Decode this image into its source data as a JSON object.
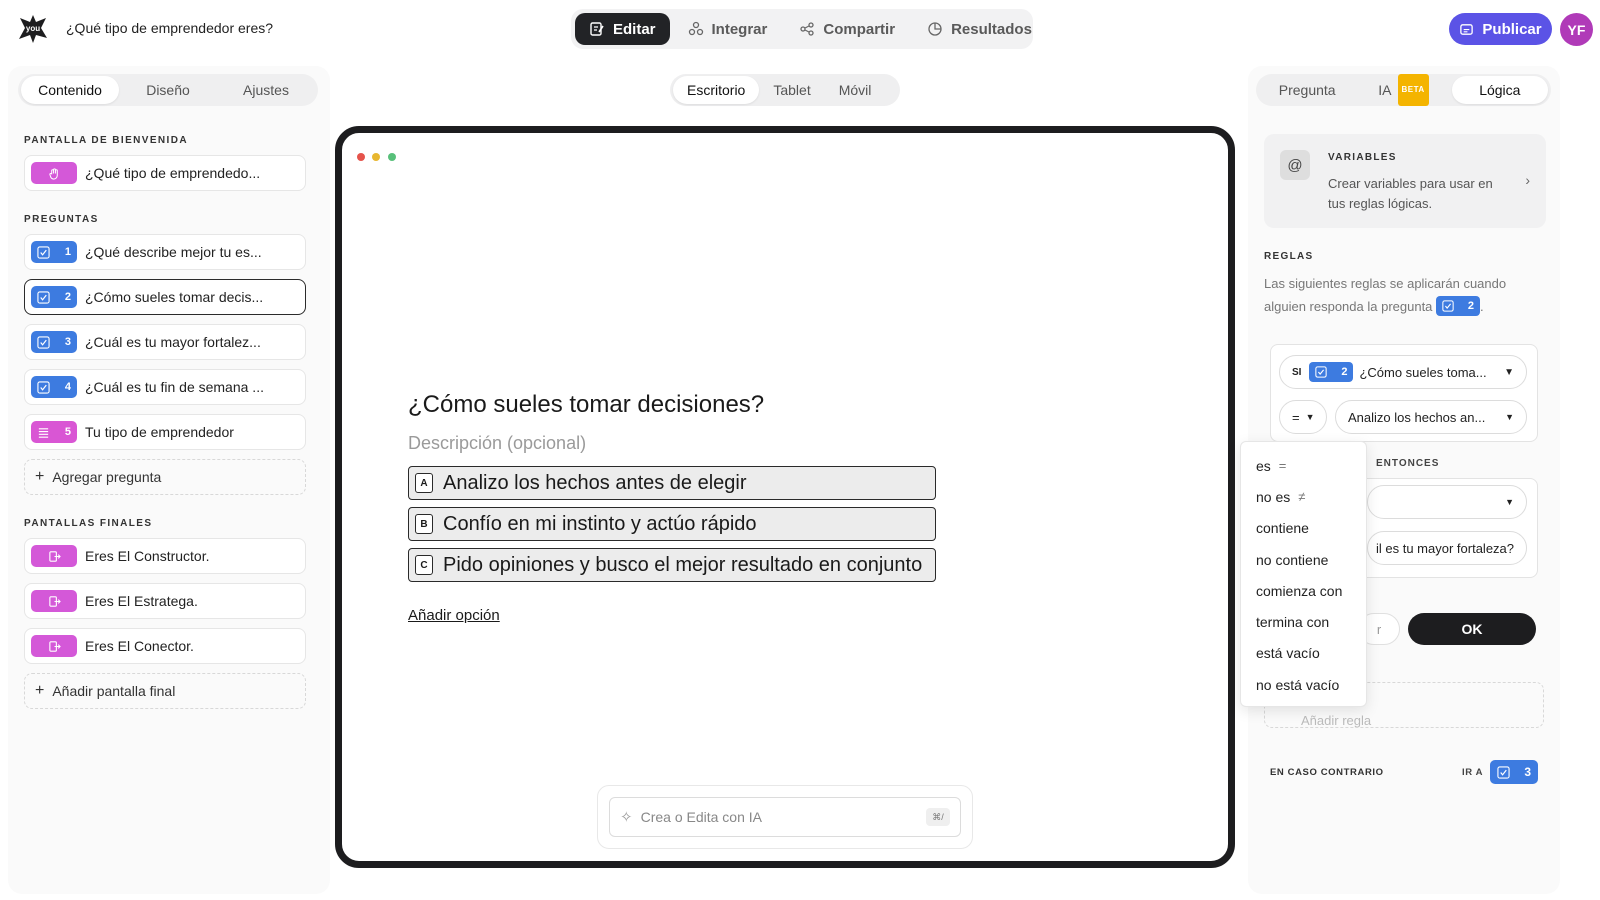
{
  "header": {
    "form_title": "¿Qué tipo de emprendedor eres?",
    "tabs": [
      {
        "label": "Editar",
        "icon": "edit-icon",
        "active": true
      },
      {
        "label": "Integrar",
        "icon": "integrate-icon"
      },
      {
        "label": "Compartir",
        "icon": "share-icon"
      },
      {
        "label": "Resultados",
        "icon": "results-icon"
      }
    ],
    "publish_label": "Publicar",
    "avatar_initials": "YF",
    "accent_color": "#5b53e6"
  },
  "left_panel": {
    "tabs": [
      "Contenido",
      "Diseño",
      "Ajustes"
    ],
    "active_tab": "Contenido",
    "welcome_label": "PANTALLA DE BIENVENIDA",
    "welcome_item": "¿Qué tipo de emprendedo...",
    "questions_label": "PREGUNTAS",
    "questions": [
      {
        "number": "1",
        "text": "¿Qué describe mejor tu es...",
        "type": "checkbox-icon"
      },
      {
        "number": "2",
        "text": "¿Cómo sueles tomar decis...",
        "type": "checkbox-icon",
        "selected": true
      },
      {
        "number": "3",
        "text": "¿Cuál es tu mayor fortalez...",
        "type": "checkbox-icon"
      },
      {
        "number": "4",
        "text": "¿Cuál es tu fin de semana ...",
        "type": "checkbox-icon"
      },
      {
        "number": "5",
        "text": "Tu tipo de emprendedor",
        "type": "list-icon"
      }
    ],
    "add_question": "Agregar pregunta",
    "endings_label": "PANTALLAS FINALES",
    "endings": [
      "Eres El Constructor.",
      "Eres El Estratega.",
      "Eres El Conector."
    ],
    "add_ending": "Añadir pantalla final"
  },
  "center": {
    "device_tabs": [
      "Escritorio",
      "Tablet",
      "Móvil"
    ],
    "active_device": "Escritorio",
    "question_title": "¿Cómo sueles tomar decisiones?",
    "description_placeholder": "Descripción (opcional)",
    "options": [
      {
        "key": "A",
        "text": "Analizo los hechos antes de elegir"
      },
      {
        "key": "B",
        "text": "Confío en mi instinto y actúo rápido"
      },
      {
        "key": "C",
        "text": "Pido opiniones y busco el mejor resultado en conjunto"
      }
    ],
    "add_option": "Añadir opción",
    "ai_placeholder": "Crea o Edita con IA",
    "ai_shortcut": "⌘/"
  },
  "right_panel": {
    "tabs": [
      "Pregunta",
      "IA",
      "Lógica"
    ],
    "beta_label": "BETA",
    "active_tab": "Lógica",
    "variables_title": "VARIABLES",
    "variables_desc": "Crear variables para usar en tus reglas lógicas.",
    "rules_title": "REGLAS",
    "rules_desc": "Las siguientes reglas se aplicarán cuando alguien responda la pregunta",
    "rules_desc_suffix": ".",
    "rule_question_number": "2",
    "rule_if_label": "SI",
    "rule_question_text": "¿Cómo sueles toma...",
    "rule_operator": "=",
    "rule_value": "Analizo los hechos an...",
    "then_label": "ENTONCES",
    "then_target": "il es tu mayor fortaleza?",
    "ghost_button": "r",
    "ok_label": "OK",
    "add_rule": "Añadir regla",
    "else_label": "EN CASO CONTRARIO",
    "goto_label": "IR A",
    "else_target_number": "3"
  },
  "operator_dropdown": [
    {
      "label": "es",
      "symbol": "="
    },
    {
      "label": "no es",
      "symbol": "≠"
    },
    {
      "label": "contiene",
      "symbol": ""
    },
    {
      "label": "no contiene",
      "symbol": ""
    },
    {
      "label": "comienza con",
      "symbol": ""
    },
    {
      "label": "termina con",
      "symbol": ""
    },
    {
      "label": "está vacío",
      "symbol": ""
    },
    {
      "label": "no está vacío",
      "symbol": ""
    }
  ]
}
